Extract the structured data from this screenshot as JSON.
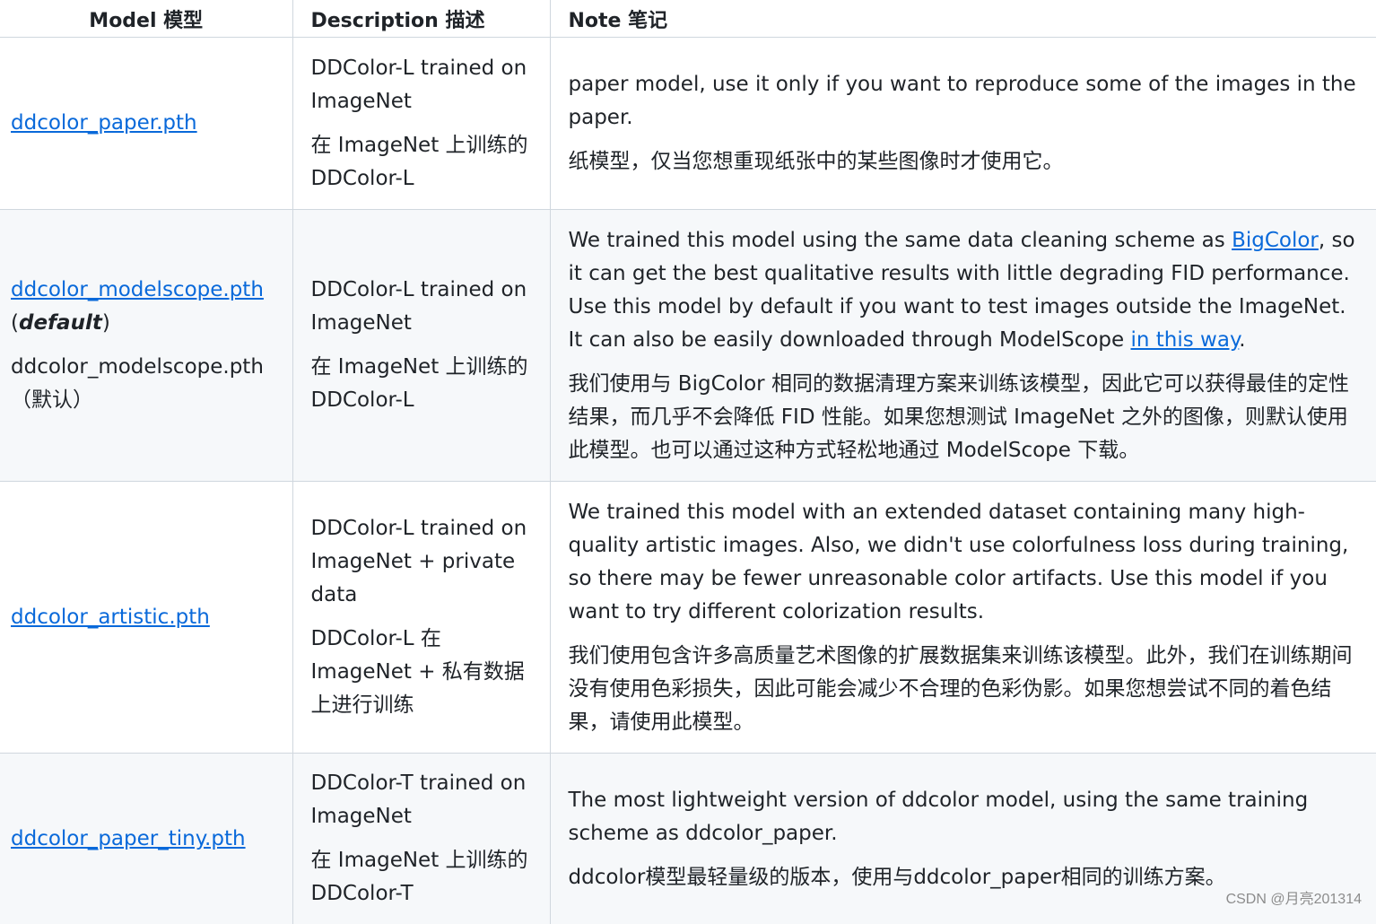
{
  "headers": {
    "model": "Model 模型",
    "description": "Description 描述",
    "note": "Note 笔记"
  },
  "rows": [
    {
      "model_link": "ddcolor_paper.pth",
      "desc_en": "DDColor-L trained on ImageNet",
      "desc_zh": "在 ImageNet 上训练的 DDColor-L",
      "note_en": "paper model, use it only if you want to reproduce some of the images in the paper.",
      "note_zh": "纸模型，仅当您想重现纸张中的某些图像时才使用它。"
    },
    {
      "model_link": "ddcolor_modelscope.pth",
      "default_open": "(",
      "default_label": "default",
      "default_close": ")",
      "model_zh": "ddcolor_modelscope.pth（默认）",
      "desc_en": "DDColor-L trained on ImageNet",
      "desc_zh": "在 ImageNet 上训练的 DDColor-L",
      "note_en_1": "We trained this model using the same data cleaning scheme as ",
      "note_link_1": "BigColor",
      "note_en_2": ", so it can get the best qualitative results with little degrading FID performance. Use this model by default if you want to test images outside the ImageNet. It can also be easily downloaded through ModelScope ",
      "note_link_2": "in this way",
      "note_en_3": ".",
      "note_zh": "我们使用与 BigColor 相同的数据清理方案来训练该模型，因此它可以获得最佳的定性结果，而几乎不会降低 FID 性能。如果您想测试 ImageNet 之外的图像，则默认使用此模型。也可以通过这种方式轻松地通过 ModelScope 下载。"
    },
    {
      "model_link": "ddcolor_artistic.pth",
      "desc_en": "DDColor-L trained on ImageNet + private data",
      "desc_zh": "DDColor-L 在 ImageNet + 私有数据上进行训练",
      "note_en": "We trained this model with an extended dataset containing many high-quality artistic images. Also, we didn't use colorfulness loss during training, so there may be fewer unreasonable color artifacts. Use this model if you want to try different colorization results.",
      "note_zh": "我们使用包含许多高质量艺术图像的扩展数据集来训练该模型。此外，我们在训练期间没有使用色彩损失，因此可能会减少不合理的色彩伪影。如果您想尝试不同的着色结果，请使用此模型。"
    },
    {
      "model_link": "ddcolor_paper_tiny.pth",
      "desc_en": "DDColor-T trained on ImageNet",
      "desc_zh": "在 ImageNet 上训练的 DDColor-T",
      "note_en": "The most lightweight version of ddcolor model, using the same training scheme as ddcolor_paper.",
      "note_zh": "ddcolor模型最轻量级的版本，使用与ddcolor_paper相同的训练方案。"
    }
  ],
  "watermark": "CSDN @月亮201314",
  "colors": {
    "link": "#0969da",
    "alt_row_bg": "#f6f8fa",
    "border": "#d0d7de",
    "text": "#1f2328"
  }
}
